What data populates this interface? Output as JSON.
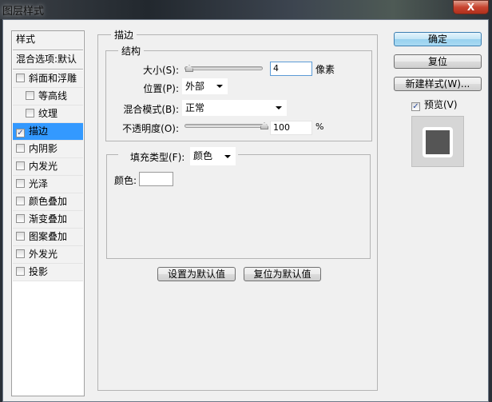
{
  "window": {
    "title": "图层样式",
    "close": "X"
  },
  "sidebar": {
    "header": "样式",
    "blend_options": "混合选项:默认",
    "items": [
      {
        "label": "斜面和浮雕",
        "checked": false
      },
      {
        "label": "等高线",
        "checked": false
      },
      {
        "label": "纹理",
        "checked": false
      },
      {
        "label": "描边",
        "checked": true
      },
      {
        "label": "内阴影",
        "checked": false
      },
      {
        "label": "内发光",
        "checked": false
      },
      {
        "label": "光泽",
        "checked": false
      },
      {
        "label": "颜色叠加",
        "checked": false
      },
      {
        "label": "渐变叠加",
        "checked": false
      },
      {
        "label": "图案叠加",
        "checked": false
      },
      {
        "label": "外发光",
        "checked": false
      },
      {
        "label": "投影",
        "checked": false
      }
    ]
  },
  "stroke": {
    "title": "描边",
    "structure": {
      "title": "结构",
      "size_label": "大小(S):",
      "size_value": "4",
      "size_unit": "像素",
      "position_label": "位置(P):",
      "position_value": "外部",
      "blend_label": "混合模式(B):",
      "blend_value": "正常",
      "opacity_label": "不透明度(O):",
      "opacity_value": "100",
      "opacity_unit": "%"
    },
    "fill": {
      "type_label": "填充类型(F):",
      "type_value": "颜色",
      "color_label": "颜色:",
      "color": "#ffffff"
    },
    "set_default": "设置为默认值",
    "reset_default": "复位为默认值"
  },
  "actions": {
    "ok": "确定",
    "reset": "复位",
    "new_style": "新建样式(W)...",
    "preview_label": "预览(V)",
    "preview_checked": true
  }
}
